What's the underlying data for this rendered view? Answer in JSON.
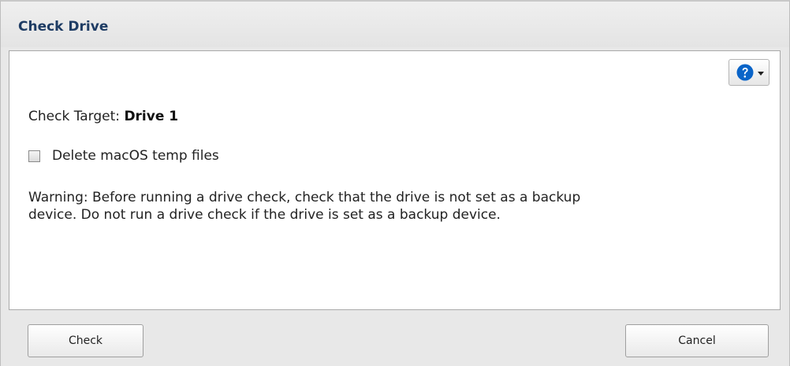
{
  "dialog": {
    "title": "Check Drive",
    "help_icon": "question-circle-icon",
    "caret_icon": "chevron-down-icon",
    "check_target_label": "Check Target:",
    "check_target_value": "Drive 1",
    "checkbox": {
      "label": "Delete macOS temp files",
      "checked": false
    },
    "warning_line1": "Warning: Before running a drive check, check that the drive is not set as a backup",
    "warning_line2": "device. Do not run a drive check if the drive is set as a backup device.",
    "buttons": {
      "check_label": "Check",
      "cancel_label": "Cancel"
    }
  },
  "colors": {
    "title": "#1e3c64",
    "help_icon": "#0a64c8",
    "background": "#e8e8e8",
    "content_background": "#ffffff"
  }
}
